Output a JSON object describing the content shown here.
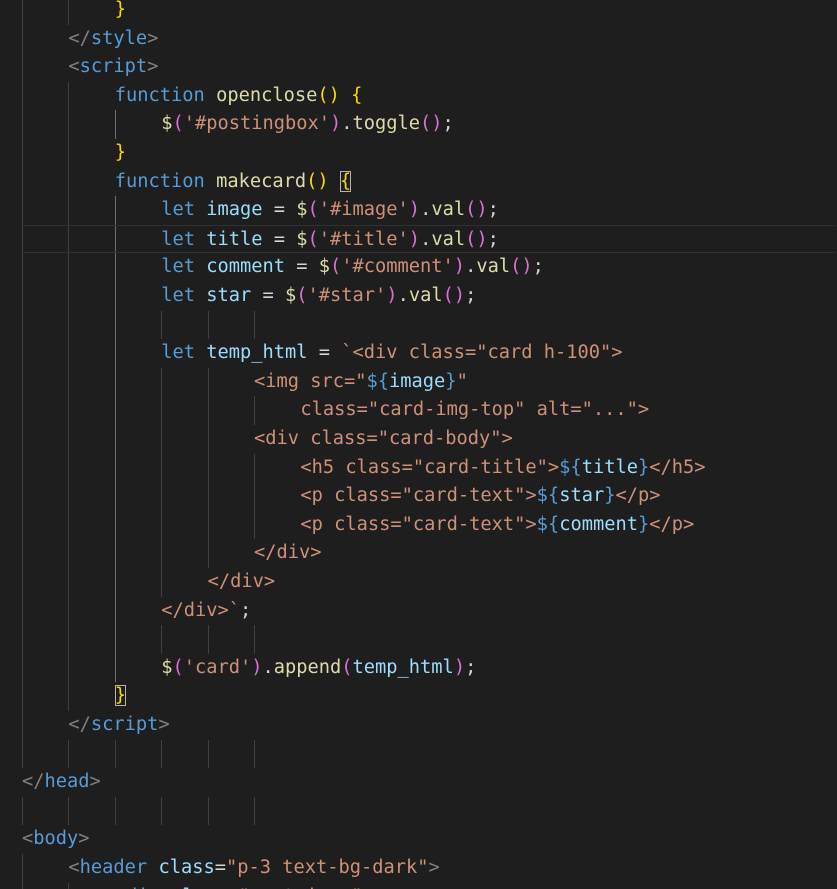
{
  "colors": {
    "background": "#1e1e1e",
    "tag_bracket": "#808080",
    "tag_name": "#569cd6",
    "attribute": "#9cdcfe",
    "string": "#ce9178",
    "keyword": "#569cd6",
    "function": "#dcdcaa",
    "variable": "#9cdcfe",
    "plain": "#d4d4d4",
    "bracket_gold": "#ffd700",
    "bracket_pink": "#da70d6",
    "bracket_blue": "#179fff"
  },
  "editor": {
    "current_line": 8,
    "lines": [
      {
        "indent": 2,
        "tokens": [
          {
            "t": "}",
            "c": "bracket_gold"
          }
        ]
      },
      {
        "indent": 1,
        "tokens": [
          {
            "t": "</",
            "c": "tag_bracket"
          },
          {
            "t": "style",
            "c": "tag_name"
          },
          {
            "t": ">",
            "c": "tag_bracket"
          }
        ]
      },
      {
        "indent": 1,
        "tokens": [
          {
            "t": "<",
            "c": "tag_bracket"
          },
          {
            "t": "script",
            "c": "tag_name"
          },
          {
            "t": ">",
            "c": "tag_bracket"
          }
        ]
      },
      {
        "indent": 2,
        "tokens": [
          {
            "t": "function",
            "c": "keyword"
          },
          {
            "t": " ",
            "c": "plain"
          },
          {
            "t": "openclose",
            "c": "function"
          },
          {
            "t": "()",
            "c": "bracket_gold"
          },
          {
            "t": " ",
            "c": "plain"
          },
          {
            "t": "{",
            "c": "bracket_gold"
          }
        ]
      },
      {
        "indent": 3,
        "tokens": [
          {
            "t": "$",
            "c": "function"
          },
          {
            "t": "(",
            "c": "bracket_pink"
          },
          {
            "t": "'#postingbox'",
            "c": "string"
          },
          {
            "t": ")",
            "c": "bracket_pink"
          },
          {
            "t": ".",
            "c": "plain"
          },
          {
            "t": "toggle",
            "c": "function"
          },
          {
            "t": "()",
            "c": "bracket_pink"
          },
          {
            "t": ";",
            "c": "plain"
          }
        ]
      },
      {
        "indent": 2,
        "tokens": [
          {
            "t": "}",
            "c": "bracket_gold"
          }
        ]
      },
      {
        "indent": 2,
        "tokens": [
          {
            "t": "function",
            "c": "keyword"
          },
          {
            "t": " ",
            "c": "plain"
          },
          {
            "t": "makecard",
            "c": "function"
          },
          {
            "t": "()",
            "c": "bracket_gold"
          },
          {
            "t": " ",
            "c": "plain"
          },
          {
            "t": "{",
            "c": "bracket_gold",
            "m": true
          }
        ]
      },
      {
        "indent": 3,
        "tokens": [
          {
            "t": "let",
            "c": "keyword"
          },
          {
            "t": " ",
            "c": "plain"
          },
          {
            "t": "image",
            "c": "variable"
          },
          {
            "t": " = ",
            "c": "plain"
          },
          {
            "t": "$",
            "c": "function"
          },
          {
            "t": "(",
            "c": "bracket_pink"
          },
          {
            "t": "'#image'",
            "c": "string"
          },
          {
            "t": ")",
            "c": "bracket_pink"
          },
          {
            "t": ".",
            "c": "plain"
          },
          {
            "t": "val",
            "c": "function"
          },
          {
            "t": "()",
            "c": "bracket_pink"
          },
          {
            "t": ";",
            "c": "plain"
          }
        ]
      },
      {
        "indent": 3,
        "tokens": [
          {
            "t": "let",
            "c": "keyword"
          },
          {
            "t": " ",
            "c": "plain"
          },
          {
            "t": "title",
            "c": "variable"
          },
          {
            "t": " = ",
            "c": "plain"
          },
          {
            "t": "$",
            "c": "function"
          },
          {
            "t": "(",
            "c": "bracket_pink"
          },
          {
            "t": "'#title'",
            "c": "string"
          },
          {
            "t": ")",
            "c": "bracket_pink"
          },
          {
            "t": ".",
            "c": "plain"
          },
          {
            "t": "val",
            "c": "function"
          },
          {
            "t": "()",
            "c": "bracket_pink"
          },
          {
            "t": ";",
            "c": "plain"
          }
        ]
      },
      {
        "indent": 3,
        "tokens": [
          {
            "t": "let",
            "c": "keyword"
          },
          {
            "t": " ",
            "c": "plain"
          },
          {
            "t": "comment",
            "c": "variable"
          },
          {
            "t": " = ",
            "c": "plain"
          },
          {
            "t": "$",
            "c": "function"
          },
          {
            "t": "(",
            "c": "bracket_pink"
          },
          {
            "t": "'#comment'",
            "c": "string"
          },
          {
            "t": ")",
            "c": "bracket_pink"
          },
          {
            "t": ".",
            "c": "plain"
          },
          {
            "t": "val",
            "c": "function"
          },
          {
            "t": "()",
            "c": "bracket_pink"
          },
          {
            "t": ";",
            "c": "plain"
          }
        ]
      },
      {
        "indent": 3,
        "tokens": [
          {
            "t": "let",
            "c": "keyword"
          },
          {
            "t": " ",
            "c": "plain"
          },
          {
            "t": "star",
            "c": "variable"
          },
          {
            "t": " = ",
            "c": "plain"
          },
          {
            "t": "$",
            "c": "function"
          },
          {
            "t": "(",
            "c": "bracket_pink"
          },
          {
            "t": "'#star'",
            "c": "string"
          },
          {
            "t": ")",
            "c": "bracket_pink"
          },
          {
            "t": ".",
            "c": "plain"
          },
          {
            "t": "val",
            "c": "function"
          },
          {
            "t": "()",
            "c": "bracket_pink"
          },
          {
            "t": ";",
            "c": "plain"
          }
        ]
      },
      {
        "indent": 0,
        "tokens": []
      },
      {
        "indent": 3,
        "tokens": [
          {
            "t": "let",
            "c": "keyword"
          },
          {
            "t": " ",
            "c": "plain"
          },
          {
            "t": "temp_html",
            "c": "variable"
          },
          {
            "t": " = ",
            "c": "plain"
          },
          {
            "t": "`<div class=\"card h-100\">",
            "c": "string"
          }
        ]
      },
      {
        "indent": 5,
        "tokens": [
          {
            "t": "<img src=\"",
            "c": "string"
          },
          {
            "t": "${",
            "c": "keyword"
          },
          {
            "t": "image",
            "c": "variable"
          },
          {
            "t": "}",
            "c": "keyword"
          },
          {
            "t": "\"",
            "c": "string"
          }
        ]
      },
      {
        "indent": 6,
        "tokens": [
          {
            "t": "class=\"card-img-top\" alt=\"...\">",
            "c": "string"
          }
        ]
      },
      {
        "indent": 5,
        "tokens": [
          {
            "t": "<div class=\"card-body\">",
            "c": "string"
          }
        ]
      },
      {
        "indent": 6,
        "tokens": [
          {
            "t": "<h5 class=\"card-title\">",
            "c": "string"
          },
          {
            "t": "${",
            "c": "keyword"
          },
          {
            "t": "title",
            "c": "variable"
          },
          {
            "t": "}",
            "c": "keyword"
          },
          {
            "t": "</h5>",
            "c": "string"
          }
        ]
      },
      {
        "indent": 6,
        "tokens": [
          {
            "t": "<p class=\"card-text\">",
            "c": "string"
          },
          {
            "t": "${",
            "c": "keyword"
          },
          {
            "t": "star",
            "c": "variable"
          },
          {
            "t": "}",
            "c": "keyword"
          },
          {
            "t": "</p>",
            "c": "string"
          }
        ]
      },
      {
        "indent": 6,
        "tokens": [
          {
            "t": "<p class=\"card-text\">",
            "c": "string"
          },
          {
            "t": "${",
            "c": "keyword"
          },
          {
            "t": "comment",
            "c": "variable"
          },
          {
            "t": "}",
            "c": "keyword"
          },
          {
            "t": "</p>",
            "c": "string"
          }
        ]
      },
      {
        "indent": 5,
        "tokens": [
          {
            "t": "</div>",
            "c": "string"
          }
        ]
      },
      {
        "indent": 4,
        "tokens": [
          {
            "t": "</div>",
            "c": "string"
          }
        ]
      },
      {
        "indent": 3,
        "tokens": [
          {
            "t": "</div>`",
            "c": "string"
          },
          {
            "t": ";",
            "c": "plain"
          }
        ]
      },
      {
        "indent": 0,
        "tokens": []
      },
      {
        "indent": 3,
        "tokens": [
          {
            "t": "$",
            "c": "function"
          },
          {
            "t": "(",
            "c": "bracket_pink"
          },
          {
            "t": "'card'",
            "c": "string"
          },
          {
            "t": ")",
            "c": "bracket_pink"
          },
          {
            "t": ".",
            "c": "plain"
          },
          {
            "t": "append",
            "c": "function"
          },
          {
            "t": "(",
            "c": "bracket_pink"
          },
          {
            "t": "temp_html",
            "c": "variable"
          },
          {
            "t": ")",
            "c": "bracket_pink"
          },
          {
            "t": ";",
            "c": "plain"
          }
        ]
      },
      {
        "indent": 2,
        "tokens": [
          {
            "t": "}",
            "c": "bracket_gold",
            "m": true
          }
        ]
      },
      {
        "indent": 1,
        "tokens": [
          {
            "t": "</",
            "c": "tag_bracket"
          },
          {
            "t": "script",
            "c": "tag_name"
          },
          {
            "t": ">",
            "c": "tag_bracket"
          }
        ]
      },
      {
        "indent": 0,
        "tokens": []
      },
      {
        "indent": 0,
        "tokens": [
          {
            "t": "</",
            "c": "tag_bracket"
          },
          {
            "t": "head",
            "c": "tag_name"
          },
          {
            "t": ">",
            "c": "tag_bracket"
          }
        ]
      },
      {
        "indent": 0,
        "tokens": []
      },
      {
        "indent": 0,
        "tokens": [
          {
            "t": "<",
            "c": "tag_bracket"
          },
          {
            "t": "body",
            "c": "tag_name"
          },
          {
            "t": ">",
            "c": "tag_bracket"
          }
        ]
      },
      {
        "indent": 1,
        "tokens": [
          {
            "t": "<",
            "c": "tag_bracket"
          },
          {
            "t": "header",
            "c": "tag_name"
          },
          {
            "t": " ",
            "c": "plain"
          },
          {
            "t": "class",
            "c": "attribute"
          },
          {
            "t": "=",
            "c": "plain"
          },
          {
            "t": "\"p-3 text-bg-dark\"",
            "c": "string"
          },
          {
            "t": ">",
            "c": "tag_bracket"
          }
        ]
      },
      {
        "indent": 2,
        "tokens": [
          {
            "t": "<",
            "c": "tag_bracket"
          },
          {
            "t": "div",
            "c": "tag_name"
          },
          {
            "t": " ",
            "c": "plain"
          },
          {
            "t": "class",
            "c": "attribute"
          },
          {
            "t": "=",
            "c": "plain"
          },
          {
            "t": "\"container\"",
            "c": "string"
          },
          {
            "t": ">",
            "c": "tag_bracket"
          }
        ]
      }
    ]
  }
}
